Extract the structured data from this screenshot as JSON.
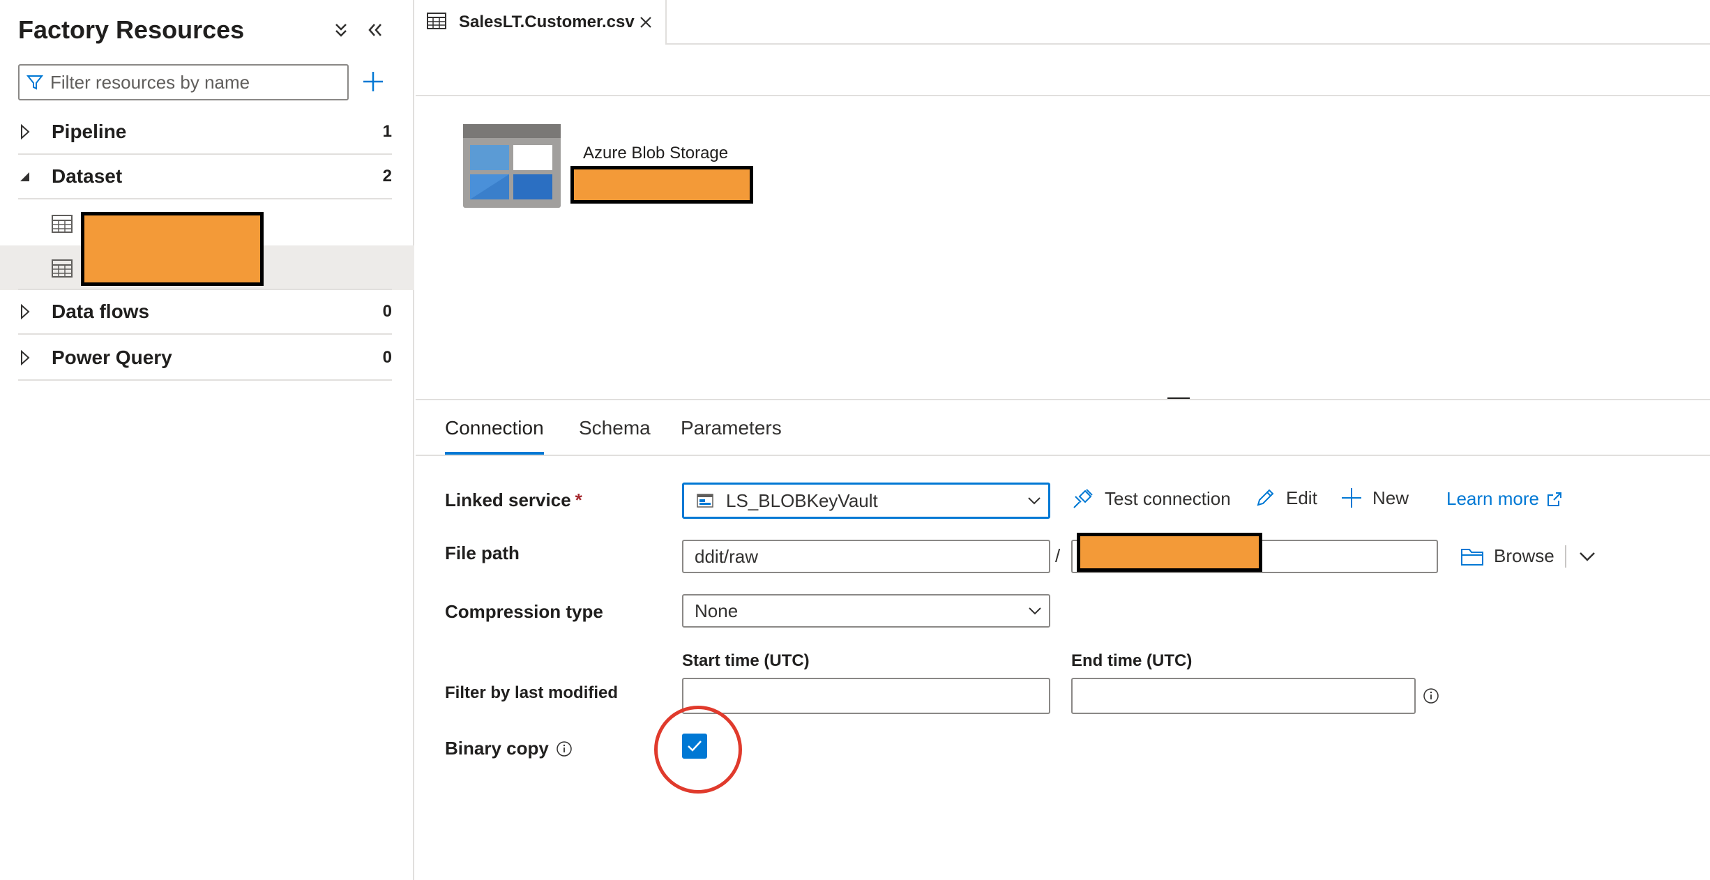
{
  "sidebar": {
    "title": "Factory Resources",
    "filter_placeholder": "Filter resources by name",
    "groups": [
      {
        "label": "Pipeline",
        "count": "1"
      },
      {
        "label": "Dataset",
        "count": "2"
      },
      {
        "label": "Data flows",
        "count": "0"
      },
      {
        "label": "Power Query",
        "count": "0"
      }
    ]
  },
  "tabs": [
    {
      "label": "SalesLT.Customer.csv"
    }
  ],
  "canvas": {
    "dataset_type": "Azure Blob Storage"
  },
  "properties": {
    "tabs": [
      {
        "label": "Connection"
      },
      {
        "label": "Schema"
      },
      {
        "label": "Parameters"
      }
    ],
    "linked_service": {
      "label": "Linked service",
      "required_mark": "*",
      "value": "LS_BLOBKeyVault",
      "test_connection": "Test connection",
      "edit": "Edit",
      "new": "New",
      "learn_more": "Learn more"
    },
    "file_path": {
      "label": "File path",
      "container": "ddit/raw",
      "separator": "/",
      "browse": "Browse"
    },
    "compression": {
      "label": "Compression type",
      "value": "None"
    },
    "filter": {
      "label": "Filter by last modified",
      "start_label": "Start time (UTC)",
      "end_label": "End time (UTC)",
      "start_value": "",
      "end_value": ""
    },
    "binary_copy": {
      "label": "Binary copy",
      "checked": true
    }
  },
  "colors": {
    "accent": "#0078d4",
    "redaction": "#f39a38",
    "highlight": "#e03a2c"
  }
}
